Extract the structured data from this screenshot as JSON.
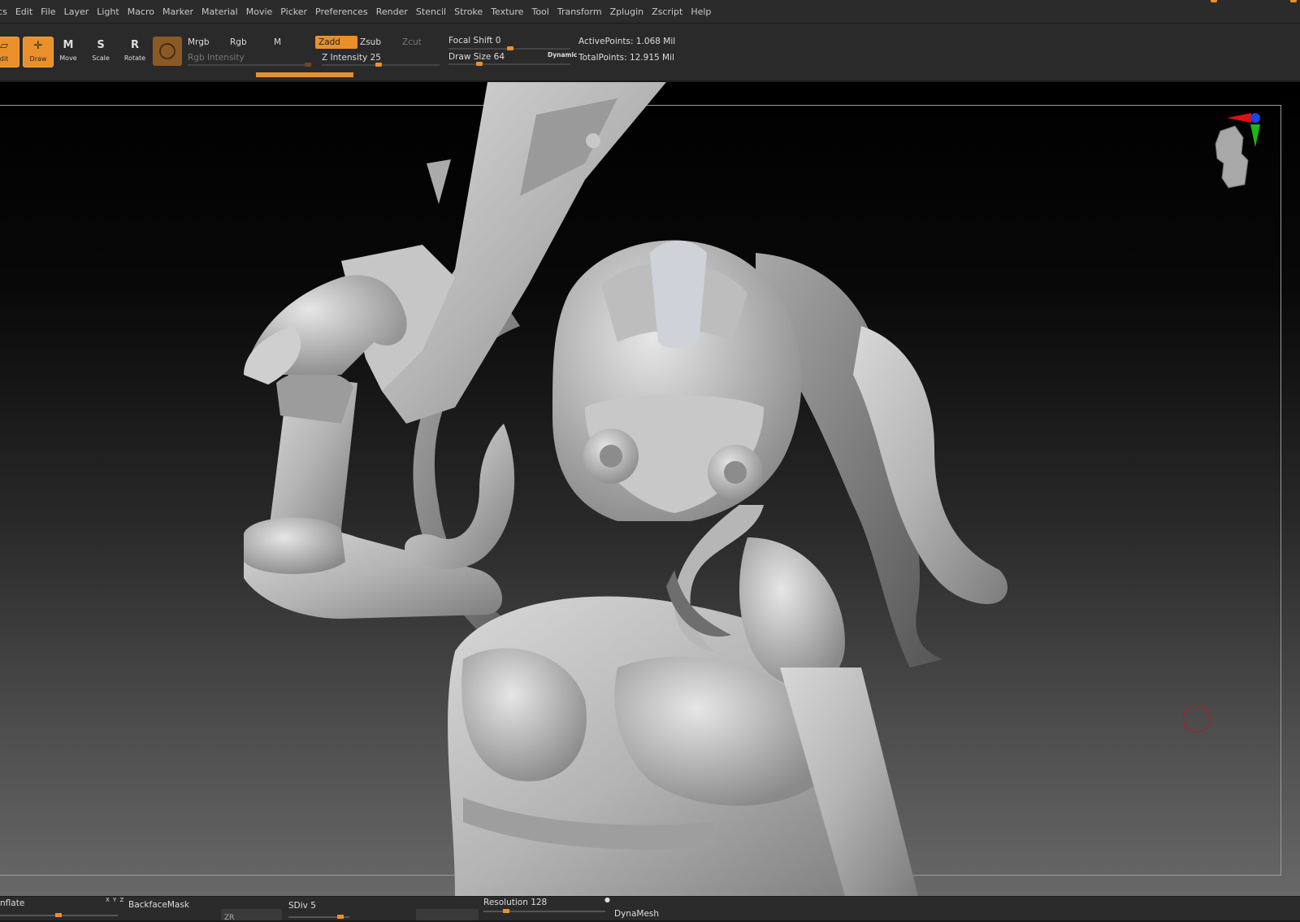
{
  "menu": {
    "items": [
      "ics",
      "Edit",
      "File",
      "Layer",
      "Light",
      "Macro",
      "Marker",
      "Material",
      "Movie",
      "Picker",
      "Preferences",
      "Render",
      "Stencil",
      "Stroke",
      "Texture",
      "Tool",
      "Transform",
      "Zplugin",
      "Zscript",
      "Help"
    ]
  },
  "toolbar": {
    "edit_label": "dit",
    "edit_icon_char": "▱",
    "draw_label": "Draw",
    "draw_icon_char": "✛",
    "move_label": "Move",
    "move_icon_char": "M",
    "scale_label": "Scale",
    "scale_icon_char": "S",
    "rotate_label": "Rotate",
    "rotate_icon_char": "R",
    "mrgb": "Mrgb",
    "rgb": "Rgb",
    "m": "M",
    "rgb_intensity": "Rgb Intensity",
    "zadd": "Zadd",
    "zsub": "Zsub",
    "zcut": "Zcut",
    "z_intensity": "Z Intensity 25",
    "focal_shift": "Focal Shift 0",
    "draw_size": "Draw Size 64",
    "dynamic": "Dynamic",
    "active_points": "ActivePoints: 1.068 Mil",
    "total_points": "TotalPoints: 12.915 Mil"
  },
  "bottom": {
    "inflate": "nflate",
    "xyz": "X Y Z",
    "backface_mask": "BackfaceMask",
    "sdiv": "SDiv 5",
    "resolution": "Resolution 128",
    "dynamesh": "DynaMesh",
    "zs_partial": "ZR"
  },
  "colors": {
    "accent": "#e9902a",
    "panel": "#2a2a2a",
    "cursor": "#c0141b",
    "model": "#b8b8b8"
  }
}
